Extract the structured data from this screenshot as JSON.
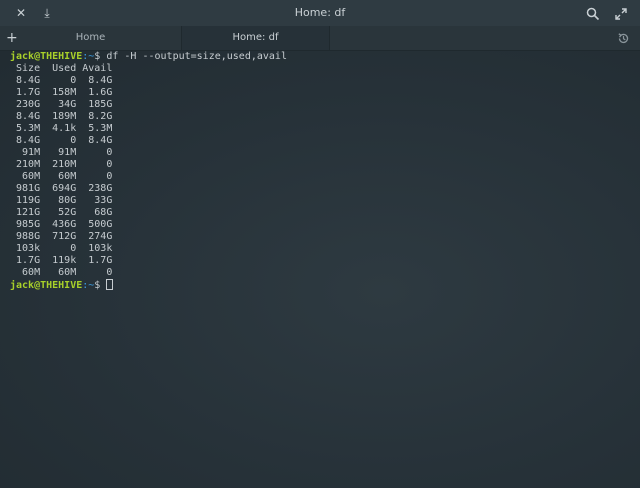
{
  "window": {
    "title": "Home: df",
    "close_icon": "✕",
    "download_icon": "⤓"
  },
  "tabs": [
    {
      "label": "Home",
      "active": false
    },
    {
      "label": "Home: df",
      "active": true
    }
  ],
  "terminal": {
    "user_host": "jack@THEHIVE",
    "path": ":~",
    "prompt_symbol": "$",
    "command": " df -H --output=size,used,avail",
    "output": [
      " Size  Used Avail",
      " 8.4G     0  8.4G",
      " 1.7G  158M  1.6G",
      " 230G   34G  185G",
      " 8.4G  189M  8.2G",
      " 5.3M  4.1k  5.3M",
      " 8.4G     0  8.4G",
      "  91M   91M     0",
      " 210M  210M     0",
      "  60M   60M     0",
      " 981G  694G  238G",
      " 119G   80G   33G",
      " 121G   52G   68G",
      " 985G  436G  500G",
      " 988G  712G  274G",
      " 103k     0  103k",
      " 1.7G  119k  1.7G",
      "  60M   60M     0"
    ]
  }
}
